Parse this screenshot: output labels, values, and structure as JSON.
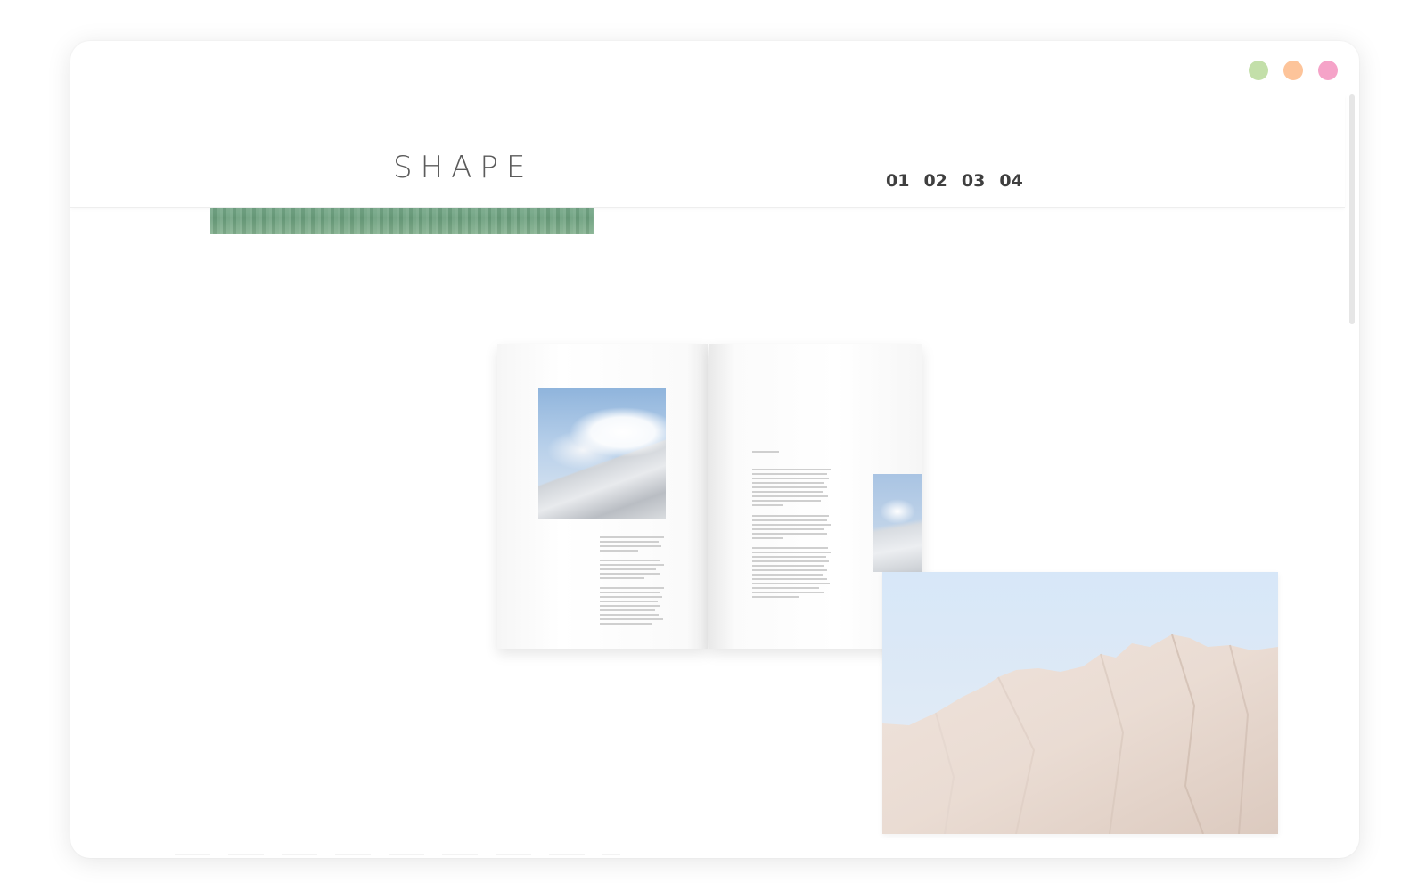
{
  "brand": {
    "logo_text": "SHAPE"
  },
  "nav": {
    "items": [
      {
        "label": "01"
      },
      {
        "label": "02"
      },
      {
        "label": "03"
      },
      {
        "label": "04"
      }
    ]
  },
  "window_controls": {
    "colors": [
      "#c3dfa9",
      "#fdc49a",
      "#f5a3c8"
    ]
  },
  "images": {
    "forest_strip": "forest-photo",
    "magazine_spread": "magazine-mockup",
    "mountain_snow": "snowy-mountain-photo",
    "sand_mountain": "sand-mountain-photo"
  },
  "colors": {
    "background": "#ffffff",
    "text_dark": "#3f3f3f",
    "logo": "#5b5b5b"
  }
}
